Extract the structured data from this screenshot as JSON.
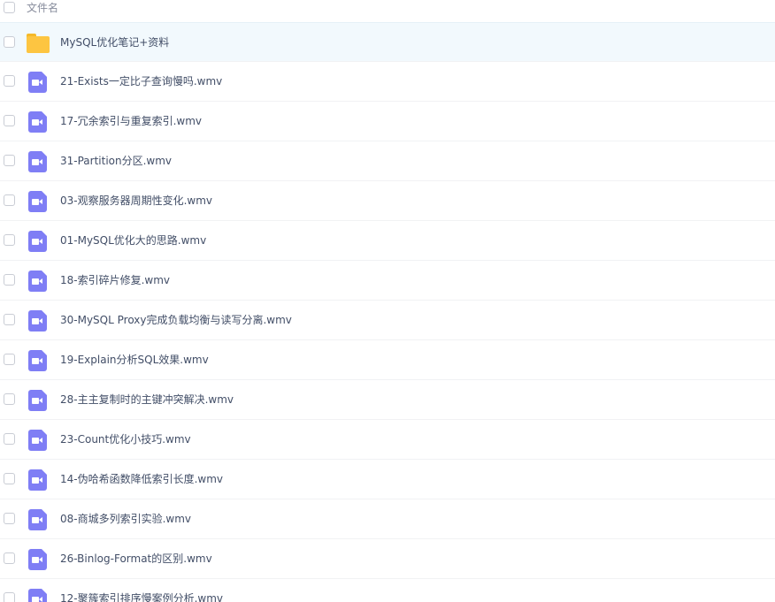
{
  "header": {
    "column_label": "文件名"
  },
  "files": [
    {
      "name": "MySQL优化笔记+资料",
      "type": "folder",
      "icon": "folder-icon",
      "selected": true
    },
    {
      "name": "21-Exists一定比子查询慢吗.wmv",
      "type": "video",
      "icon": "video-file-icon"
    },
    {
      "name": "17-冗余索引与重复索引.wmv",
      "type": "video",
      "icon": "video-file-icon"
    },
    {
      "name": "31-Partition分区.wmv",
      "type": "video",
      "icon": "video-file-icon"
    },
    {
      "name": "03-观察服务器周期性变化.wmv",
      "type": "video",
      "icon": "video-file-icon"
    },
    {
      "name": "01-MySQL优化大的思路.wmv",
      "type": "video",
      "icon": "video-file-icon"
    },
    {
      "name": "18-索引碎片修复.wmv",
      "type": "video",
      "icon": "video-file-icon"
    },
    {
      "name": "30-MySQL Proxy完成负载均衡与读写分离.wmv",
      "type": "video",
      "icon": "video-file-icon"
    },
    {
      "name": "19-Explain分析SQL效果.wmv",
      "type": "video",
      "icon": "video-file-icon"
    },
    {
      "name": "28-主主复制时的主键冲突解决.wmv",
      "type": "video",
      "icon": "video-file-icon"
    },
    {
      "name": "23-Count优化小技巧.wmv",
      "type": "video",
      "icon": "video-file-icon"
    },
    {
      "name": "14-伪哈希函数降低索引长度.wmv",
      "type": "video",
      "icon": "video-file-icon"
    },
    {
      "name": "08-商城多列索引实验.wmv",
      "type": "video",
      "icon": "video-file-icon"
    },
    {
      "name": "26-Binlog-Format的区别.wmv",
      "type": "video",
      "icon": "video-file-icon"
    },
    {
      "name": "12-聚簇索引排序慢案例分析.wmv",
      "type": "video",
      "icon": "video-file-icon"
    }
  ]
}
